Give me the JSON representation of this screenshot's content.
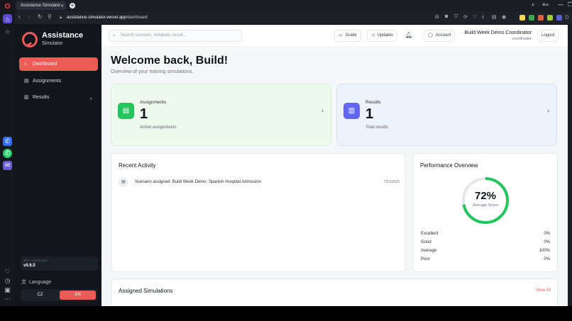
{
  "browser": {
    "tab_title": "Assistance Simulator",
    "url_host": "assistance-simulator.vercel.app",
    "url_path": "/dashboard"
  },
  "sidebar": {
    "brand_title": "Assistance",
    "brand_sub": "Simulator",
    "items": [
      {
        "label": "Dashboard",
        "icon": "home-icon",
        "active": true
      },
      {
        "label": "Assignments",
        "icon": "clipboard-icon",
        "active": false
      },
      {
        "label": "Results",
        "icon": "results-icon",
        "active": false,
        "has_chevron": true
      }
    ],
    "version_label": "APP VERSION",
    "version_value": "v0.6.5",
    "language_label": "Language",
    "lang_options": [
      "CZ",
      "EN"
    ],
    "lang_selected": "EN"
  },
  "topbar": {
    "search_placeholder": "Search scenario, template, result...",
    "guide_label": "Guide",
    "updates_label": "Updates",
    "account_label": "Account",
    "user_name": "Build Week Demo Coordinator",
    "user_role": "coordinator",
    "logout_label": "Logout"
  },
  "dashboard": {
    "welcome": "Welcome back, Build!",
    "welcome_sub": "Overview of your training simulations.",
    "stats": [
      {
        "label": "Assignments",
        "value": "1",
        "sub": "Active assignments",
        "color": "#22c55e"
      },
      {
        "label": "Results",
        "value": "1",
        "sub": "Total results",
        "color": "#6366f1"
      }
    ],
    "recent_title": "Recent Activity",
    "activity": [
      {
        "text": "Scenario assigned: Build Week Demo: Spanish Hospital Admission",
        "date": "7/21/2026"
      }
    ],
    "performance": {
      "title": "Performance Overview",
      "score": "72%",
      "score_fraction": 0.72,
      "score_label": "Average Score",
      "ring_color": "#22c55e",
      "rows": [
        {
          "label": "Excellent",
          "value": "0%"
        },
        {
          "label": "Good",
          "value": "0%"
        },
        {
          "label": "Average",
          "value": "100%"
        },
        {
          "label": "Poor",
          "value": "0%"
        }
      ]
    },
    "assigned_title": "Assigned Simulations",
    "view_all": "View All"
  }
}
